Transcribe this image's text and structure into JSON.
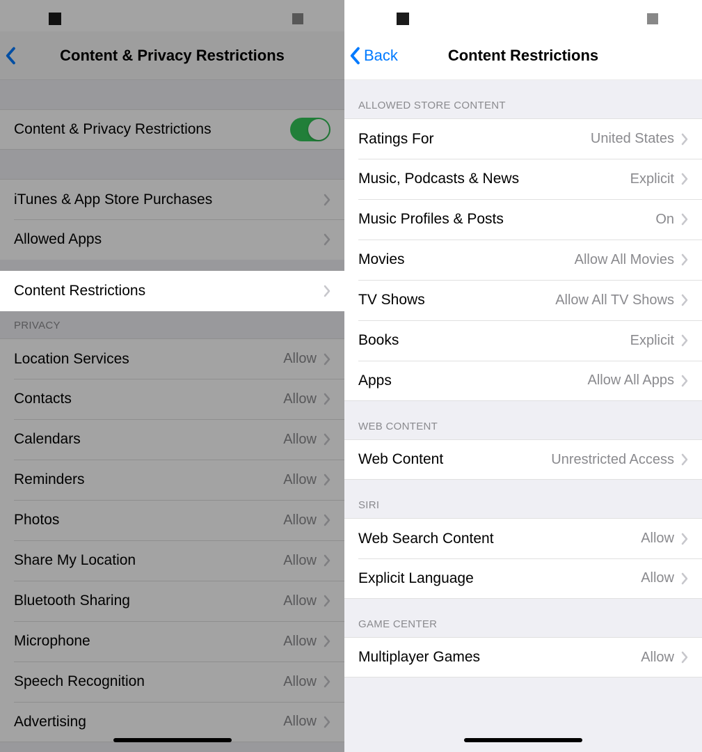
{
  "left": {
    "nav": {
      "title": "Content & Privacy Restrictions"
    },
    "toggleRow": {
      "label": "Content & Privacy Restrictions"
    },
    "group1": {
      "itunes": "iTunes & App Store Purchases",
      "allowedApps": "Allowed Apps",
      "contentRestrictions": "Content Restrictions"
    },
    "privacyHeader": "PRIVACY",
    "privacyItems": [
      {
        "label": "Location Services",
        "value": "Allow"
      },
      {
        "label": "Contacts",
        "value": "Allow"
      },
      {
        "label": "Calendars",
        "value": "Allow"
      },
      {
        "label": "Reminders",
        "value": "Allow"
      },
      {
        "label": "Photos",
        "value": "Allow"
      },
      {
        "label": "Share My Location",
        "value": "Allow"
      },
      {
        "label": "Bluetooth Sharing",
        "value": "Allow"
      },
      {
        "label": "Microphone",
        "value": "Allow"
      },
      {
        "label": "Speech Recognition",
        "value": "Allow"
      },
      {
        "label": "Advertising",
        "value": "Allow"
      }
    ]
  },
  "right": {
    "nav": {
      "back": "Back",
      "title": "Content Restrictions"
    },
    "allowedHeader": "ALLOWED STORE CONTENT",
    "allowedItems": [
      {
        "label": "Ratings For",
        "value": "United States"
      },
      {
        "label": "Music, Podcasts & News",
        "value": "Explicit"
      },
      {
        "label": "Music Profiles & Posts",
        "value": "On"
      },
      {
        "label": "Movies",
        "value": "Allow All Movies"
      },
      {
        "label": "TV Shows",
        "value": "Allow All TV Shows"
      },
      {
        "label": "Books",
        "value": "Explicit"
      },
      {
        "label": "Apps",
        "value": "Allow All Apps"
      }
    ],
    "webHeader": "WEB CONTENT",
    "webItem": {
      "label": "Web Content",
      "value": "Unrestricted Access"
    },
    "siriHeader": "SIRI",
    "siriItems": [
      {
        "label": "Web Search Content",
        "value": "Allow"
      },
      {
        "label": "Explicit Language",
        "value": "Allow"
      }
    ],
    "gcHeader": "GAME CENTER",
    "gcItems": [
      {
        "label": "Multiplayer Games",
        "value": "Allow"
      }
    ]
  }
}
